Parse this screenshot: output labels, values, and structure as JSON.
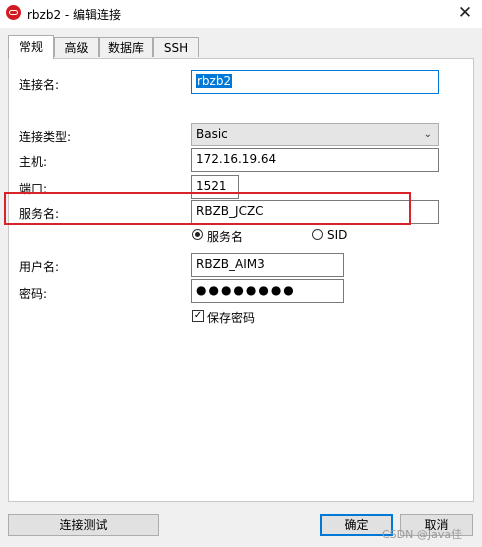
{
  "window": {
    "title": "rbzb2 - 编辑连接",
    "close_glyph": "✕"
  },
  "tabs": [
    {
      "label": "常规",
      "active": true
    },
    {
      "label": "高级",
      "active": false
    },
    {
      "label": "数据库",
      "active": false
    },
    {
      "label": "SSH",
      "active": false
    }
  ],
  "form": {
    "connection_name_label": "连接名:",
    "connection_name_value": "rbzb2",
    "connection_type_label": "连接类型:",
    "connection_type_value": "Basic",
    "host_label": "主机:",
    "host_value": "172.16.19.64",
    "port_label": "端口:",
    "port_value": "1521",
    "service_name_label": "服务名:",
    "service_name_value": "RBZB_JCZC",
    "radio_service_name": "服务名",
    "radio_sid": "SID",
    "username_label": "用户名:",
    "username_value": "RBZB_AIM3",
    "password_label": "密码:",
    "password_mask": "●●●●●●●●",
    "save_password_label": "保存密码",
    "save_password_checked": true
  },
  "buttons": {
    "test_connection": "连接测试",
    "ok": "确定",
    "cancel": "取消"
  },
  "watermark": "CSDN @Java佳",
  "colors": {
    "highlight": "#d9232a",
    "accent": "#0078d7",
    "brand": "#d41a22"
  }
}
